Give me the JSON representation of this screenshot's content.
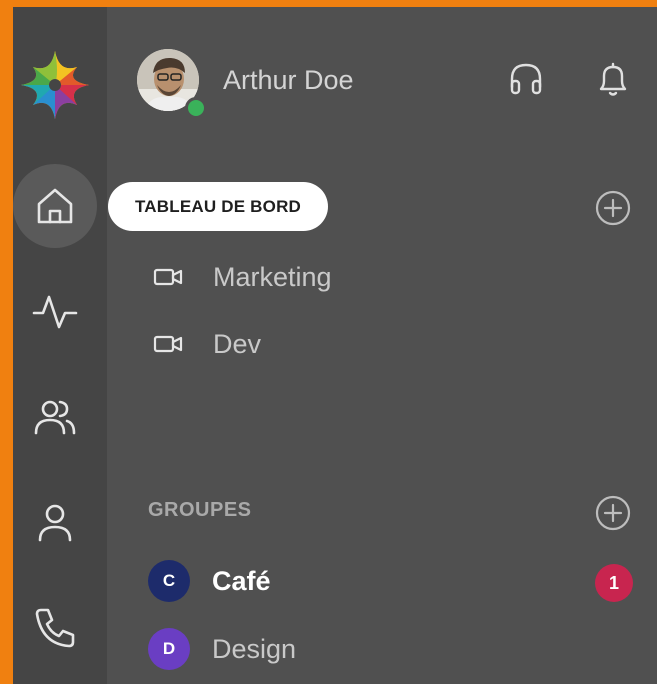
{
  "user": {
    "name": "Arthur Doe",
    "status": "online"
  },
  "tooltip": {
    "label": "TABLEAU DE BORD"
  },
  "rooms": [
    {
      "name": "Marketing",
      "icon": "video-icon"
    },
    {
      "name": "Dev",
      "icon": "video-icon"
    }
  ],
  "groups": {
    "title": "GROUPES",
    "items": [
      {
        "initial": "C",
        "name": "Café",
        "color": "#1d2b6b",
        "unread": 1
      },
      {
        "initial": "D",
        "name": "Design",
        "color": "#6a3ec3",
        "unread": null
      }
    ]
  },
  "colors": {
    "accent": "#f08010",
    "sidebar": "#454545",
    "panel": "#505050",
    "online": "#3ab25a",
    "badge": "#c8254f"
  }
}
